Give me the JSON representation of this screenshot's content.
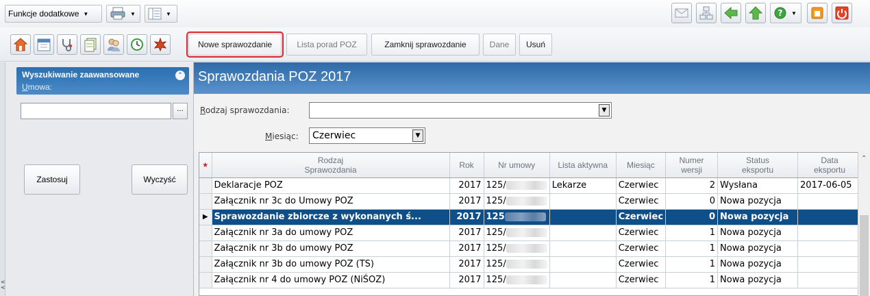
{
  "toolbar": {
    "funkcje_label": "Funkcje dodatkowe",
    "buttons": {
      "nowe": "Nowe sprawozdanie",
      "lista": "Lista porad POZ",
      "zamknij": "Zamknij sprawozdanie",
      "dane": "Dane",
      "usun": "Usuń"
    }
  },
  "left_panel": {
    "title": "Wyszukiwanie zaawansowane",
    "umowa_label_first": "U",
    "umowa_label_rest": "mowa:",
    "umowa_value": "",
    "dots": "...",
    "zastosuj": "Zastosuj",
    "wyczysc": "Wyczyść"
  },
  "main": {
    "title": "Sprawozdania POZ 2017",
    "rodzaj_label_first": "R",
    "rodzaj_label_rest": "odzaj sprawozdania:",
    "rodzaj_value": "",
    "miesiac_label_first": "M",
    "miesiac_label_rest": "iesiąc:",
    "miesiac_value": "Czerwiec"
  },
  "table": {
    "headers": {
      "rodzaj_l1": "Rodzaj",
      "rodzaj_l2": "Sprawozdania",
      "rok": "Rok",
      "nr_umowy": "Nr umowy",
      "lista_aktywna": "Lista aktywna",
      "miesiac": "Miesiąc",
      "numer_l1": "Numer",
      "numer_l2": "wersji",
      "status_l1": "Status",
      "status_l2": "eksportu",
      "data_l1": "Data",
      "data_l2": "eksportu"
    },
    "rows": [
      {
        "rodzaj": "Deklaracje POZ",
        "rok": "2017",
        "nr": "125/",
        "lista": "Lekarze",
        "miesiac": "Czerwiec",
        "wersja": "2",
        "status": "Wysłana",
        "data": "2017-06-05"
      },
      {
        "rodzaj": "Załącznik nr 3c do Umowy POZ",
        "rok": "2017",
        "nr": "125/",
        "lista": "",
        "miesiac": "Czerwiec",
        "wersja": "0",
        "status": "Nowa pozycja",
        "data": ""
      },
      {
        "rodzaj": "Sprawozdanie zbiorcze z wykonanych ś...",
        "rok": "2017",
        "nr": "125",
        "lista": "",
        "miesiac": "Czerwiec",
        "wersja": "0",
        "status": "Nowa pozycja",
        "data": ""
      },
      {
        "rodzaj": "Załącznik nr 3a do umowy POZ",
        "rok": "2017",
        "nr": "125/",
        "lista": "",
        "miesiac": "Czerwiec",
        "wersja": "1",
        "status": "Nowa pozycja",
        "data": ""
      },
      {
        "rodzaj": "Załącznik nr 3b do umowy POZ",
        "rok": "2017",
        "nr": "125/",
        "lista": "",
        "miesiac": "Czerwiec",
        "wersja": "1",
        "status": "Nowa pozycja",
        "data": ""
      },
      {
        "rodzaj": "Załącznik nr 3b do umowy POZ (TS)",
        "rok": "2017",
        "nr": "125/",
        "lista": "",
        "miesiac": "Czerwiec",
        "wersja": "1",
        "status": "Nowa pozycja",
        "data": ""
      },
      {
        "rodzaj": "Załącznik nr 4 do umowy POZ (NiŚOZ)",
        "rok": "2017",
        "nr": "125/",
        "lista": "",
        "miesiac": "Czerwiec",
        "wersja": "1",
        "status": "Nowa pozycja",
        "data": ""
      }
    ],
    "selected_row": 2
  },
  "colors": {
    "header_blue": "#2e6aa6",
    "selection": "#0f4f89",
    "highlight_red": "#d6262e"
  },
  "icons": [
    "home-icon",
    "calendar-icon",
    "stethoscope-icon",
    "documents-icon",
    "users-icon",
    "clock-icon",
    "leaf-icon",
    "printer-icon",
    "list-icon",
    "mail-icon",
    "network-icon",
    "back-arrow-icon",
    "up-arrow-icon",
    "help-icon",
    "lock-icon",
    "power-icon"
  ]
}
